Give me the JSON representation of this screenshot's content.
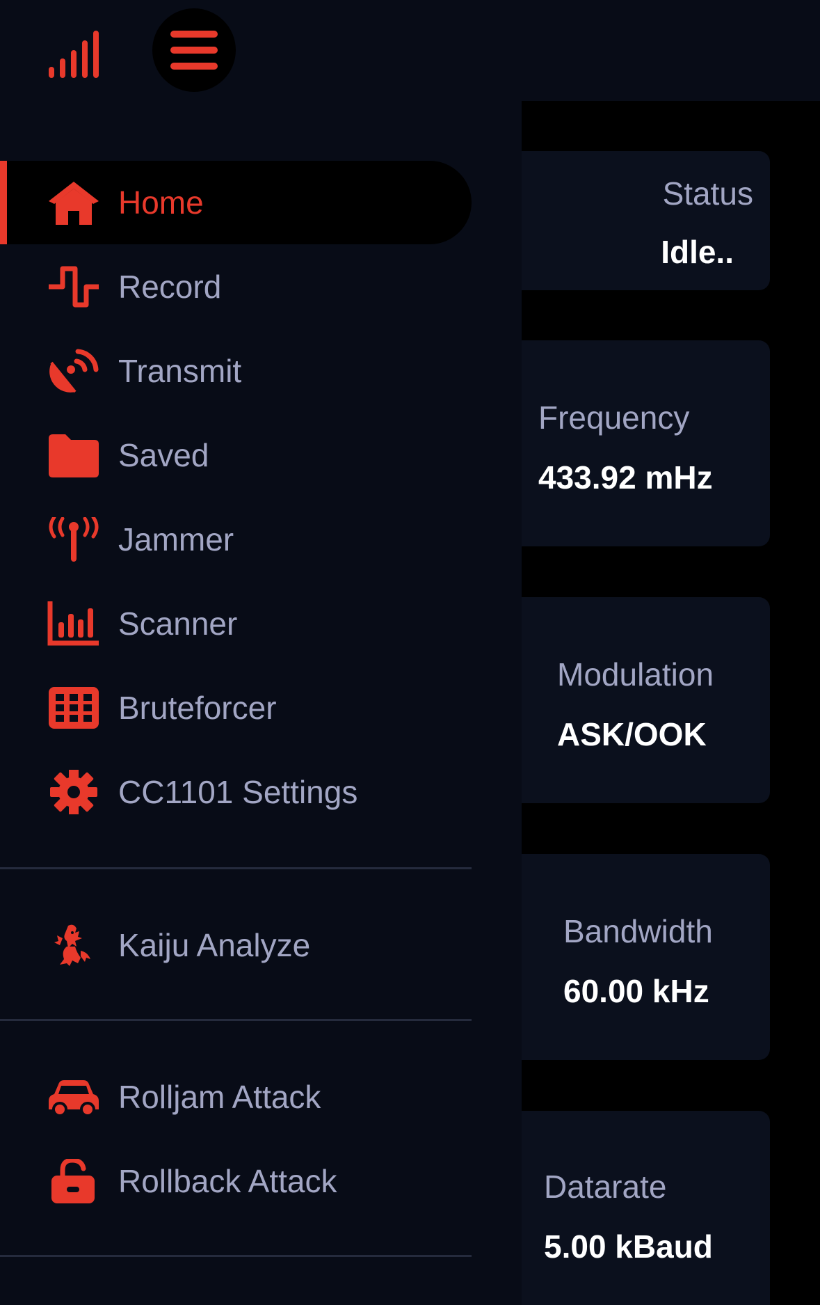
{
  "colors": {
    "accent": "#e8392b",
    "text_muted": "#a2a6c4",
    "value": "#ffffff",
    "background": "#080c17"
  },
  "header": {
    "signal_icon": "signal-bars-icon",
    "menu_icon": "hamburger-menu-icon"
  },
  "nav": {
    "primary": [
      {
        "label": "Home",
        "icon": "home-icon",
        "active": true
      },
      {
        "label": "Record",
        "icon": "waveform-icon",
        "active": false
      },
      {
        "label": "Transmit",
        "icon": "satellite-dish-icon",
        "active": false
      },
      {
        "label": "Saved",
        "icon": "folder-icon",
        "active": false
      },
      {
        "label": "Jammer",
        "icon": "antenna-icon",
        "active": false
      },
      {
        "label": "Scanner",
        "icon": "bar-chart-icon",
        "active": false
      },
      {
        "label": "Bruteforcer",
        "icon": "grid-icon",
        "active": false
      },
      {
        "label": "CC1101 Settings",
        "icon": "gear-icon",
        "active": false
      }
    ],
    "secondary": [
      {
        "label": "Kaiju Analyze",
        "icon": "kaiju-icon"
      }
    ],
    "attacks": [
      {
        "label": "Rolljam Attack",
        "icon": "car-icon"
      },
      {
        "label": "Rollback Attack",
        "icon": "unlock-icon"
      }
    ]
  },
  "status_cards": [
    {
      "label": "Status",
      "value": "Idle.."
    },
    {
      "label": "Frequency",
      "value": "433.92 mHz"
    },
    {
      "label": "Modulation",
      "value": "ASK/OOK"
    },
    {
      "label": "Bandwidth",
      "value": "60.00 kHz"
    },
    {
      "label": "Datarate",
      "value": "5.00 kBaud"
    }
  ]
}
